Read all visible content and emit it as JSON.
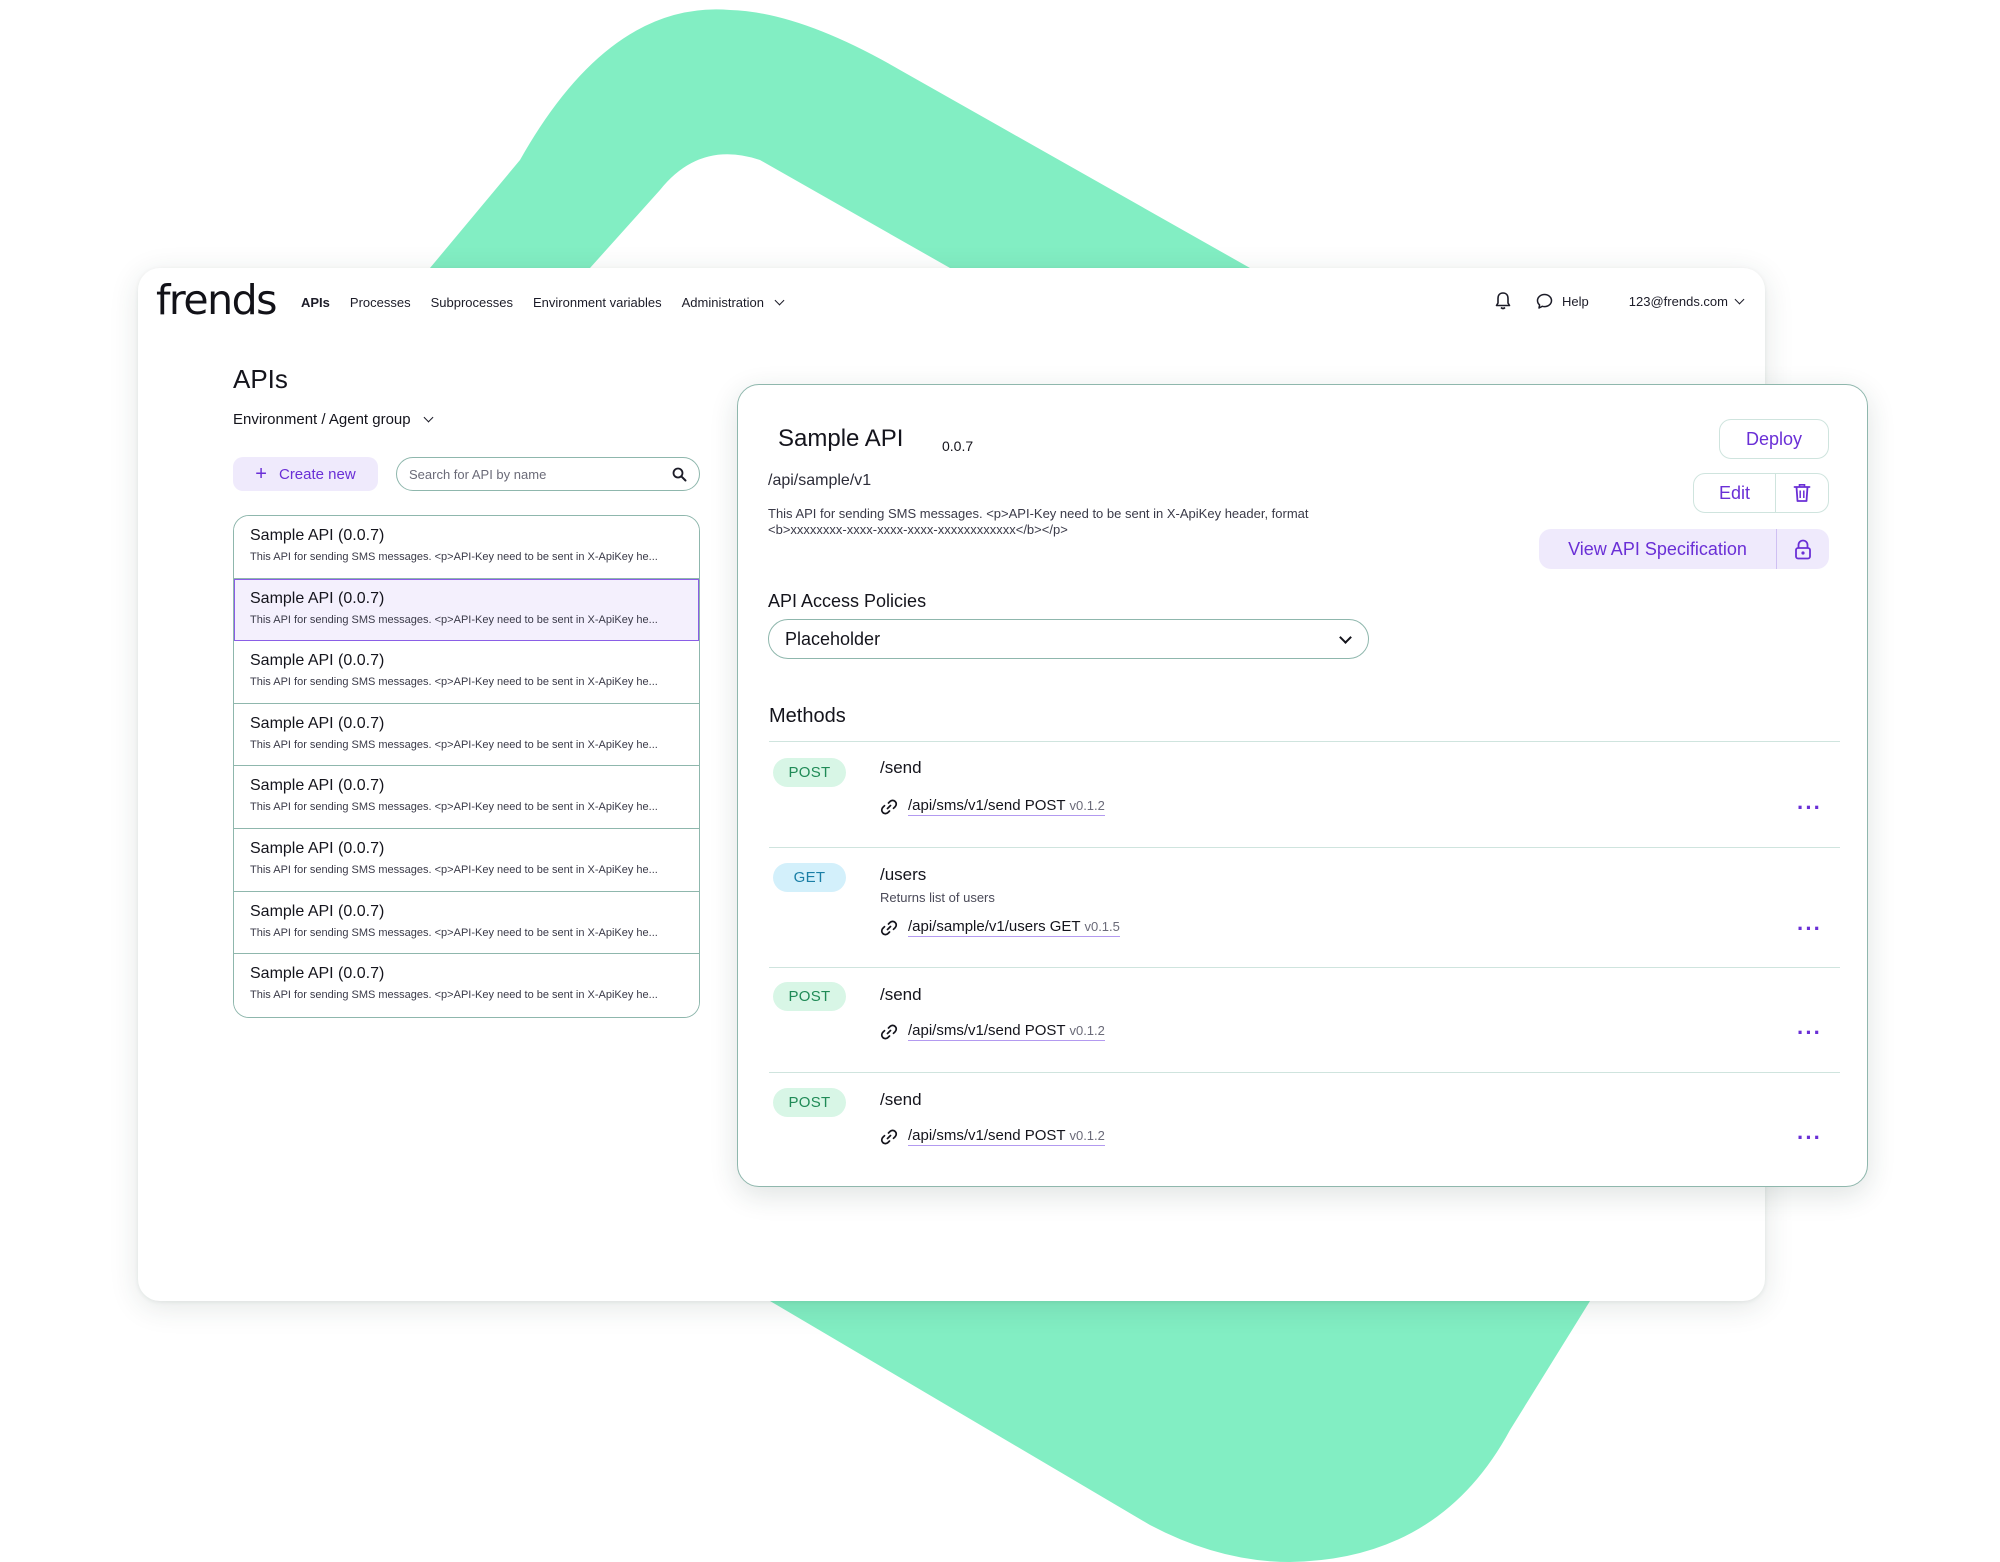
{
  "brand": {
    "logo_text": "frends",
    "accent": "#6a2fd6",
    "green": "#82eec3"
  },
  "nav": {
    "items": [
      "APIs",
      "Processes",
      "Subprocesses",
      "Environment variables"
    ],
    "administration": "Administration",
    "help": "Help",
    "user": "123@frends.com"
  },
  "left": {
    "title": "APIs",
    "environment": "Environment / Agent group",
    "create_label": "Create new",
    "search_placeholder": "Search for API by name",
    "items": [
      {
        "name": "Sample API (0.0.7)",
        "desc": "This API for sending SMS messages. <p>API-Key need to be sent in X-ApiKey he..."
      },
      {
        "name": "Sample API (0.0.7)",
        "desc": "This API for sending SMS messages. <p>API-Key need to be sent in X-ApiKey he..."
      },
      {
        "name": "Sample API (0.0.7)",
        "desc": "This API for sending SMS messages. <p>API-Key need to be sent in X-ApiKey he..."
      },
      {
        "name": "Sample API (0.0.7)",
        "desc": "This API for sending SMS messages. <p>API-Key need to be sent in X-ApiKey he..."
      },
      {
        "name": "Sample API (0.0.7)",
        "desc": "This API for sending SMS messages. <p>API-Key need to be sent in X-ApiKey he..."
      },
      {
        "name": "Sample API (0.0.7)",
        "desc": "This API for sending SMS messages. <p>API-Key need to be sent in X-ApiKey he..."
      },
      {
        "name": "Sample API (0.0.7)",
        "desc": "This API for sending SMS messages. <p>API-Key need to be sent in X-ApiKey he..."
      },
      {
        "name": "Sample API (0.0.7)",
        "desc": "This API for sending SMS messages. <p>API-Key need to be sent in X-ApiKey he..."
      }
    ]
  },
  "detail": {
    "title": "Sample API",
    "version": "0.0.7",
    "path": "/api/sample/v1",
    "description": "This API for sending SMS messages. <p>API-Key need to be sent in X-ApiKey header, format <b>xxxxxxxx-xxxx-xxxx-xxxx-xxxxxxxxxxxx</b></p>",
    "deploy_label": "Deploy",
    "edit_label": "Edit",
    "spec_label": "View API Specification",
    "policies_label": "API Access Policies",
    "policies_value": "Placeholder",
    "methods_label": "Methods",
    "methods": [
      {
        "verb": "POST",
        "path": "/send",
        "sub": "",
        "url": "/api/sms/v1/send POST",
        "ver": "v0.1.2"
      },
      {
        "verb": "GET",
        "path": "/users",
        "sub": "Returns list of users",
        "url": "/api/sample/v1/users GET",
        "ver": "v0.1.5"
      },
      {
        "verb": "POST",
        "path": "/send",
        "sub": "",
        "url": "/api/sms/v1/send POST",
        "ver": "v0.1.2"
      },
      {
        "verb": "POST",
        "path": "/send",
        "sub": "",
        "url": "/api/sms/v1/send POST",
        "ver": "v0.1.2"
      }
    ]
  }
}
